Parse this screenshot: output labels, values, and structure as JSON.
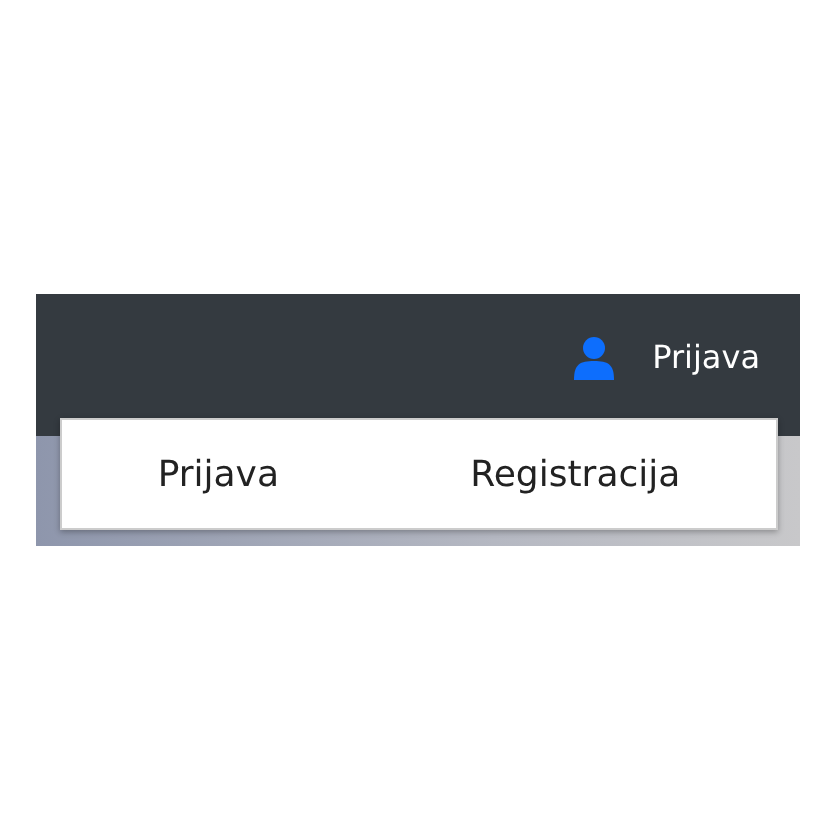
{
  "navbar": {
    "user_menu": {
      "label": "Prijava"
    }
  },
  "dropdown": {
    "items": [
      {
        "label": "Prijava"
      },
      {
        "label": "Registracija"
      }
    ]
  }
}
